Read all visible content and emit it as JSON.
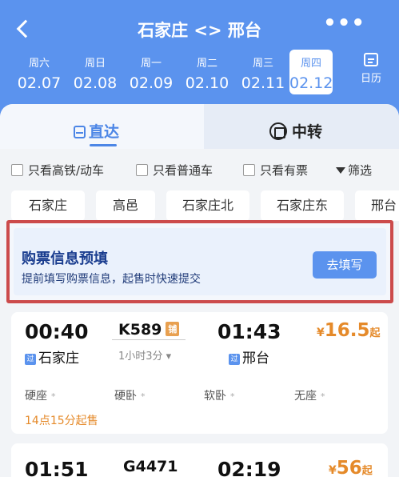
{
  "header": {
    "title": "石家庄 <> 邢台",
    "more_label": "•••",
    "calendar_label": "日历"
  },
  "dates": [
    {
      "weekday": "周六",
      "date": "02.07"
    },
    {
      "weekday": "周日",
      "date": "02.08"
    },
    {
      "weekday": "周一",
      "date": "02.09"
    },
    {
      "weekday": "周二",
      "date": "02.10"
    },
    {
      "weekday": "周三",
      "date": "02.11"
    },
    {
      "weekday": "周四",
      "date": "02.12",
      "selected": true
    }
  ],
  "tabs": {
    "direct": "直达",
    "transfer": "中转"
  },
  "filters": {
    "gaotie": "只看高铁/动车",
    "putong": "只看普通车",
    "youpiao": "只看有票",
    "shaixuan": "筛选"
  },
  "stations": [
    "石家庄",
    "高邑",
    "石家庄北",
    "石家庄东",
    "邢台"
  ],
  "promo": {
    "title": "购票信息预填",
    "subtitle": "提前填写购票信息，起售时快速提交",
    "button": "去填写"
  },
  "trains": [
    {
      "depart_time": "00:40",
      "number": "K589",
      "bunk_tag": "铺",
      "duration": "1小时3分",
      "arrive_time": "01:43",
      "price_yen": "¥",
      "price": "16.5",
      "price_suffix": "起",
      "from_tag": "过",
      "from": "石家庄",
      "to_tag": "过",
      "to": "邢台",
      "seats": [
        "硬座",
        "硬卧",
        "软卧",
        "无座"
      ],
      "seat_star": "*",
      "sale_note": "14点15分起售"
    },
    {
      "depart_time": "01:51",
      "number": "G4471",
      "arrive_time": "02:19",
      "price_yen": "¥",
      "price": "56",
      "price_suffix": "起"
    }
  ],
  "colors": {
    "header_bg": "#5b93ee",
    "accent": "#4c86e6",
    "price": "#e58a2a",
    "highlight_border": "#cc4b4b"
  }
}
